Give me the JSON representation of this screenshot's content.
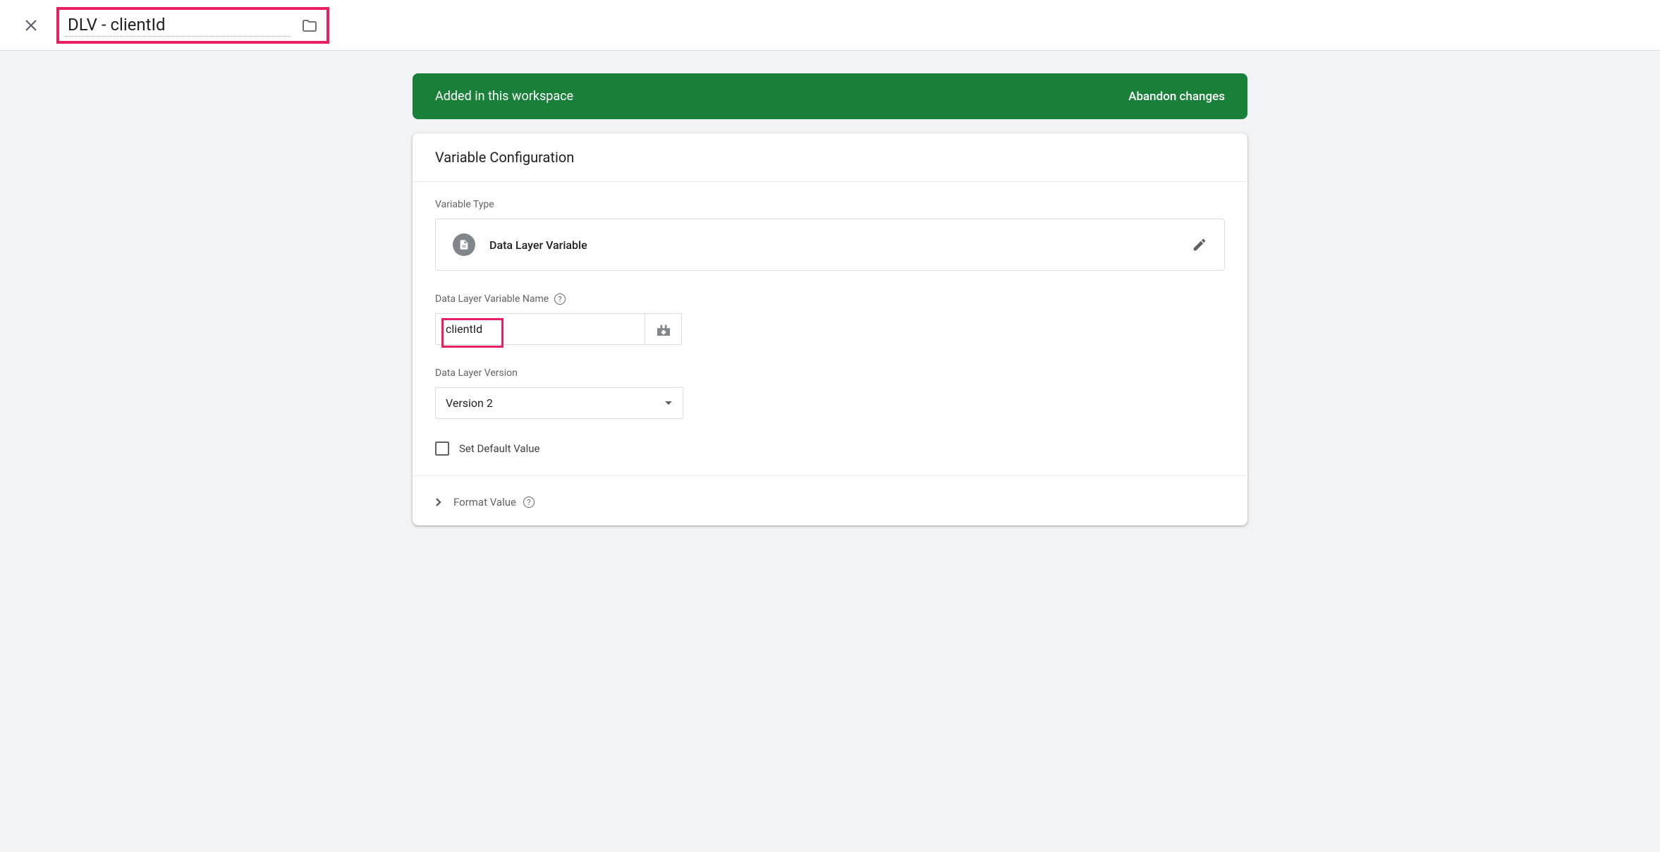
{
  "header": {
    "title": "DLV - clientId"
  },
  "banner": {
    "status_text": "Added in this workspace",
    "abandon_label": "Abandon changes"
  },
  "config": {
    "section_title": "Variable Configuration",
    "variable_type_label": "Variable Type",
    "variable_type_name": "Data Layer Variable",
    "dlv_name_label": "Data Layer Variable Name",
    "dlv_name_value": "clientId",
    "dlv_version_label": "Data Layer Version",
    "dlv_version_value": "Version 2",
    "set_default_label": "Set Default Value",
    "format_value_label": "Format Value"
  }
}
